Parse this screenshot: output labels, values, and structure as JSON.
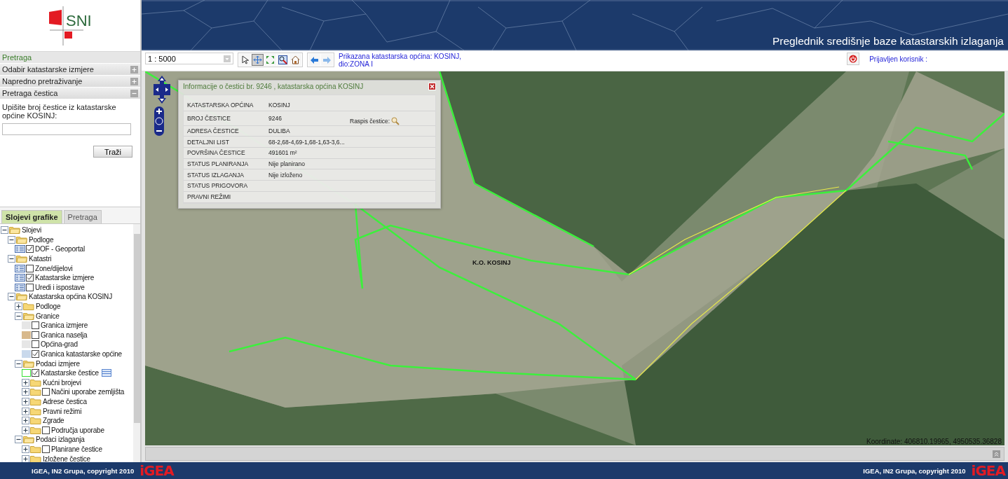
{
  "logo": {
    "text": "SNI"
  },
  "header": {
    "title": "Preglednik središnje baze katastarskih izlaganja"
  },
  "search_panel": {
    "title": "Pretraga",
    "sections": [
      {
        "label": "Odabir katastarske izmjere",
        "expanded": false
      },
      {
        "label": "Napredno pretraživanje",
        "expanded": false
      },
      {
        "label": "Pretraga čestica",
        "expanded": true
      }
    ],
    "prompt": "Upišite broj čestice iz katastarske općine KOSINJ:",
    "button": "Traži"
  },
  "tabs": [
    {
      "label": "Slojevi grafike",
      "selected": true
    },
    {
      "label": "Pretraga",
      "selected": false
    }
  ],
  "tree": [
    {
      "label": "Slojevi",
      "kind": "folder",
      "expanded": true,
      "children": [
        {
          "label": "Podloge",
          "kind": "folder",
          "expanded": true,
          "children": [
            {
              "label": "DOF - Geoportal",
              "kind": "listlayer",
              "checked": true
            }
          ]
        },
        {
          "label": "Katastri",
          "kind": "folder",
          "expanded": true,
          "children": [
            {
              "label": "Zone/dijelovi",
              "kind": "listlayer",
              "checked": false
            },
            {
              "label": "Katastarske izmjere",
              "kind": "listlayer",
              "checked": true
            },
            {
              "label": "Uredi i ispostave",
              "kind": "listlayer",
              "checked": false
            }
          ]
        },
        {
          "label": "Katastarska općina KOSINJ",
          "kind": "folder",
          "expanded": true,
          "children": [
            {
              "label": "Podloge",
              "kind": "folder",
              "expanded": false
            },
            {
              "label": "Granice",
              "kind": "folder",
              "expanded": true,
              "children": [
                {
                  "label": "Granica izmjere",
                  "kind": "swatchlayer",
                  "color": "#e6e6e6",
                  "checked": false
                },
                {
                  "label": "Granica naselja",
                  "kind": "swatchlayer",
                  "color": "#d8b98c",
                  "checked": false
                },
                {
                  "label": "Općina-grad",
                  "kind": "swatchlayer",
                  "color": "#e6e6e6",
                  "checked": false
                },
                {
                  "label": "Granica katastarske općine",
                  "kind": "swatchlayer",
                  "color": "#c9d9ec",
                  "checked": true
                }
              ]
            },
            {
              "label": "Podaci izmjere",
              "kind": "folder",
              "expanded": true,
              "children": [
                {
                  "label": "Katastarske čestice",
                  "kind": "outlinelayer",
                  "color": "#33e033",
                  "checked": true
                },
                {
                  "label": "Kućni brojevi",
                  "kind": "folder",
                  "expanded": false
                },
                {
                  "label": "Načini uporabe zemljišta",
                  "kind": "folder",
                  "expanded": false,
                  "checked": false
                },
                {
                  "label": "Adrese čestica",
                  "kind": "folder",
                  "expanded": false
                },
                {
                  "label": "Pravni režimi",
                  "kind": "folder",
                  "expanded": false
                },
                {
                  "label": "Zgrade",
                  "kind": "folder",
                  "expanded": false
                },
                {
                  "label": "Područja uporabe",
                  "kind": "folder",
                  "expanded": false,
                  "checked": false
                }
              ]
            },
            {
              "label": "Podaci izlaganja",
              "kind": "folder",
              "expanded": true,
              "children": [
                {
                  "label": "Planirane čestice",
                  "kind": "folder",
                  "expanded": false,
                  "checked": false
                },
                {
                  "label": "Izložene čestice",
                  "kind": "folder",
                  "expanded": false
                }
              ]
            }
          ]
        }
      ]
    }
  ],
  "toolbar": {
    "scale": "1 : 5000",
    "tools": [
      {
        "kind": "pointer",
        "selected": false
      },
      {
        "kind": "pan",
        "selected": true
      },
      {
        "kind": "extent",
        "selected": false
      },
      {
        "kind": "zoombox",
        "selected": false
      },
      {
        "kind": "home",
        "selected": false
      }
    ],
    "status": [
      "Prikazana katastarska općina: KOSINJ,",
      "dio:ZONA  I"
    ],
    "user_label": "Prijavljen korisnik :"
  },
  "info_popup": {
    "title": "Informacije o čestici br. 9246 , katastarska općina KOSINJ",
    "rows": [
      {
        "label": "KATASTARSKA OPĆINA",
        "value": "KOSINJ"
      },
      {
        "label": "BROJ ČESTICE",
        "value": "9246",
        "extra": "Raspis čestice:"
      },
      {
        "label": "ADRESA ČESTICE",
        "value": "DULIBA"
      },
      {
        "label": "DETALJNI LIST",
        "value": "68-2,68-4,69-1,68-1,63-3,6..."
      },
      {
        "label": "POVRŠINA ČESTICE",
        "value": "491601 m²"
      },
      {
        "label": "STATUS PLANIRANJA",
        "value": "Nije planirano"
      },
      {
        "label": "STATUS IZLAGANJA",
        "value": "Nije izloženo"
      },
      {
        "label": "STATUS PRIGOVORA"
      },
      {
        "label": "PRAVNI REŽIMI"
      }
    ]
  },
  "map": {
    "area_label": "K.O. KOSINJ",
    "coordinates": "Koordinate:  406810.19965, 4950535.36828"
  },
  "footer": {
    "left": {
      "text": "IGEA, IN2 Grupa, copyright 2010",
      "logo": "iGEA"
    },
    "right": {
      "text": "IGEA, IN2 Grupa, copyright 2010",
      "logo": "iGEA"
    }
  }
}
